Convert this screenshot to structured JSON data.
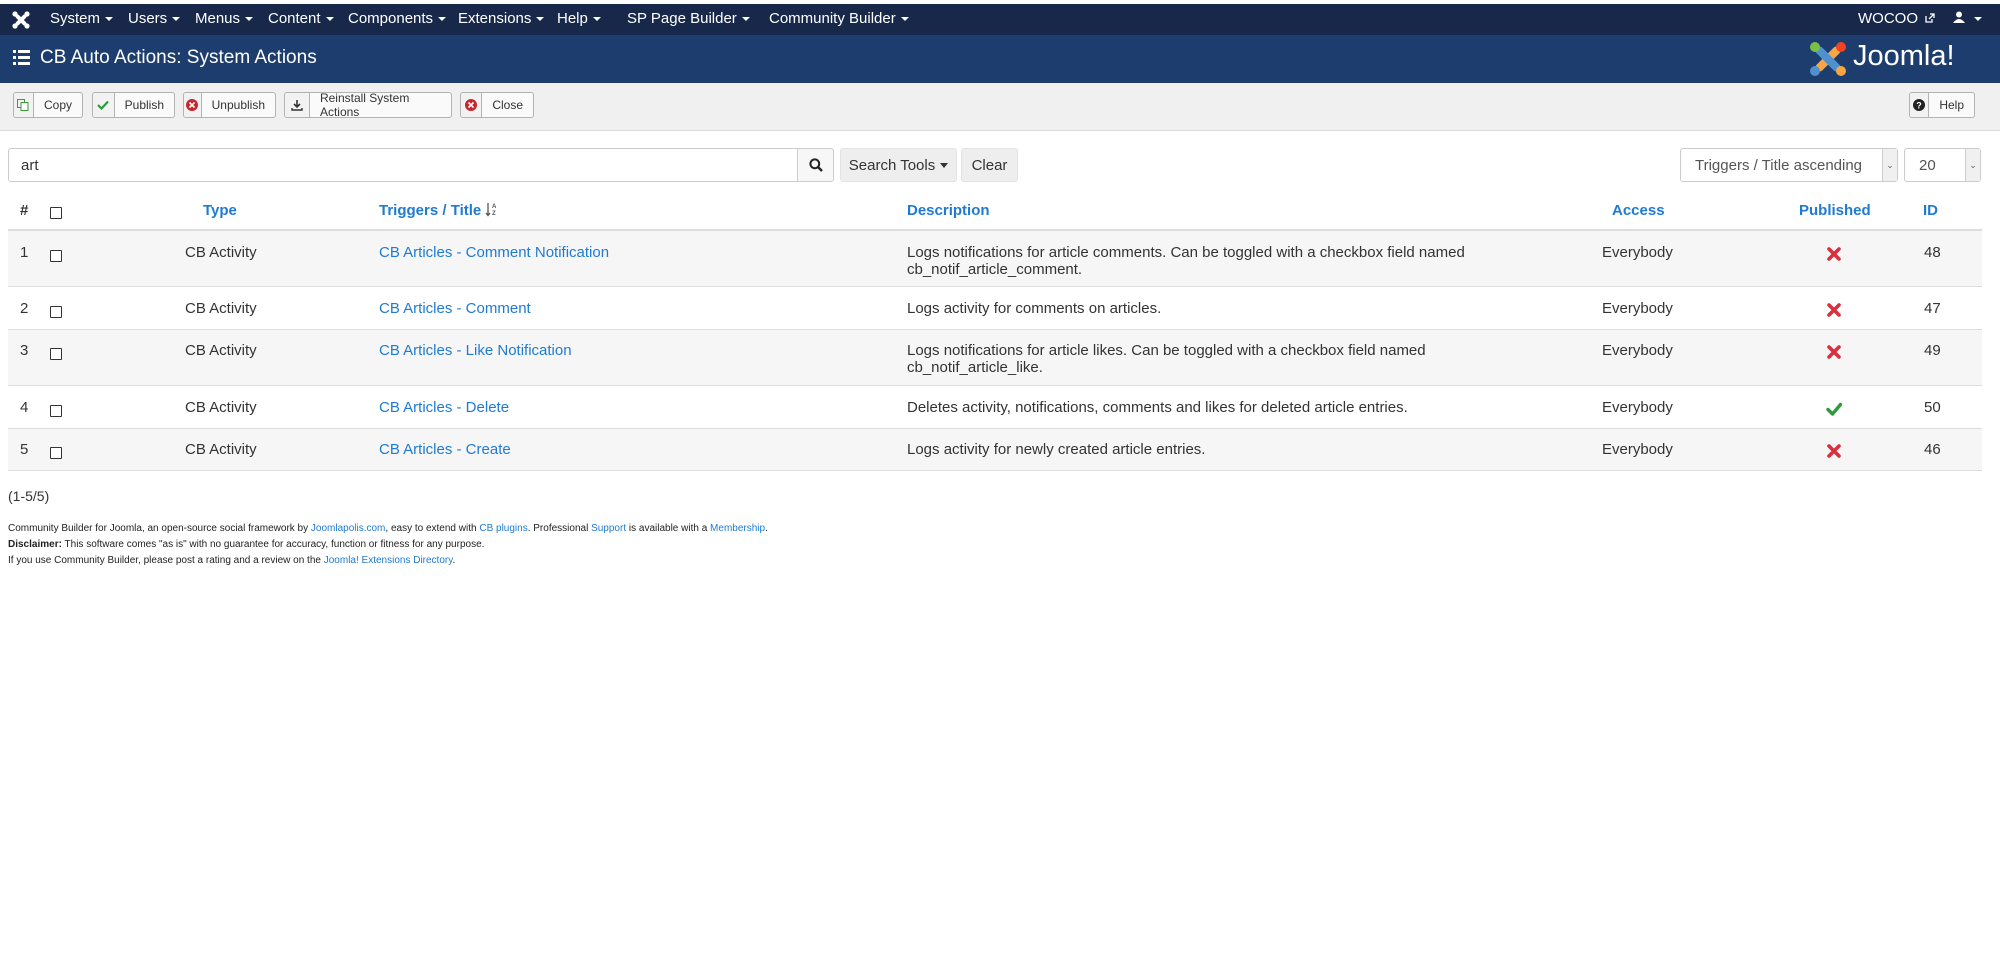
{
  "nav": {
    "menus": [
      "System",
      "Users",
      "Menus",
      "Content",
      "Components",
      "Extensions",
      "Help",
      "SP Page Builder",
      "Community Builder"
    ],
    "site_link": "WOCOO"
  },
  "header": {
    "title": "CB Auto Actions: System Actions",
    "brand": "Joomla!"
  },
  "toolbar": {
    "copy": "Copy",
    "publish": "Publish",
    "unpublish": "Unpublish",
    "reinstall": "Reinstall System Actions",
    "close": "Close",
    "help": "Help"
  },
  "filters": {
    "search_value": "art",
    "search_tools": "Search Tools",
    "clear": "Clear",
    "ordering": "Triggers / Title ascending",
    "limit": "20"
  },
  "table": {
    "headers": {
      "num": "#",
      "type": "Type",
      "title": "Triggers / Title",
      "description": "Description",
      "access": "Access",
      "published": "Published",
      "id": "ID"
    },
    "rows": [
      {
        "num": "1",
        "type": "CB Activity",
        "title": "CB Articles - Comment Notification",
        "desc1": "Logs notifications for article comments. Can be toggled with a checkbox field named",
        "desc2": "cb_notif_article_comment.",
        "access": "Everybody",
        "published": false,
        "id": "48"
      },
      {
        "num": "2",
        "type": "CB Activity",
        "title": "CB Articles - Comment",
        "desc1": "Logs activity for comments on articles.",
        "desc2": "",
        "access": "Everybody",
        "published": false,
        "id": "47"
      },
      {
        "num": "3",
        "type": "CB Activity",
        "title": "CB Articles - Like Notification",
        "desc1": "Logs notifications for article likes. Can be toggled with a checkbox field named",
        "desc2": "cb_notif_article_like.",
        "access": "Everybody",
        "published": false,
        "id": "49"
      },
      {
        "num": "4",
        "type": "CB Activity",
        "title": "CB Articles - Delete",
        "desc1": "Deletes activity, notifications, comments and likes for deleted article entries.",
        "desc2": "",
        "access": "Everybody",
        "published": true,
        "id": "50"
      },
      {
        "num": "5",
        "type": "CB Activity",
        "title": "CB Articles - Create",
        "desc1": "Logs activity for newly created article entries.",
        "desc2": "",
        "access": "Everybody",
        "published": false,
        "id": "46"
      }
    ]
  },
  "pagination": "(1-5/5)",
  "footer": {
    "l1_a": "Community Builder for Joomla, an open-source social framework by ",
    "l1_link1": "Joomlapolis.com",
    "l1_b": ", easy to extend with ",
    "l1_link2": "CB plugins",
    "l1_c": ". Professional ",
    "l1_link3": "Support",
    "l1_d": " is available with a ",
    "l1_link4": "Membership",
    "l1_e": ".",
    "l2_bold": "Disclaimer:",
    "l2_rest": " This software comes \"as is\" with no guarantee for accuracy, function or fitness for any purpose.",
    "l3_a": "If you use Community Builder, please post a rating and a review on the ",
    "l3_link": "Joomla! Extensions Directory",
    "l3_b": "."
  },
  "colors": {
    "nav_bg": "#17284a",
    "title_bg": "#1c3d6e",
    "link": "#1f7bd2",
    "unpublished": "#d9303e",
    "published": "#2f9a3c"
  }
}
